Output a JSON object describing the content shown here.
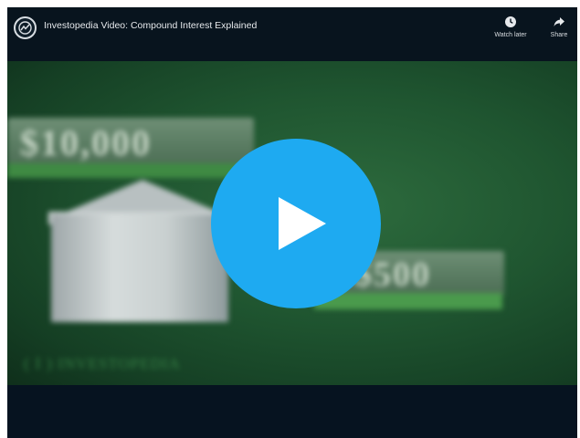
{
  "player": {
    "title": "Investopedia Video: Compound Interest Explained",
    "channel_logo_icon": "investopedia-logo-icon",
    "watch_later_label": "Watch later",
    "watch_later_icon": "clock-icon",
    "share_label": "Share",
    "share_icon": "share-arrow-icon",
    "play_icon": "play-icon",
    "accent_color": "#1eaaf1"
  },
  "frame": {
    "bill_large_text": "$10,000",
    "bill_small_text": "$500",
    "watermark": "INVESTOPEDIA"
  }
}
